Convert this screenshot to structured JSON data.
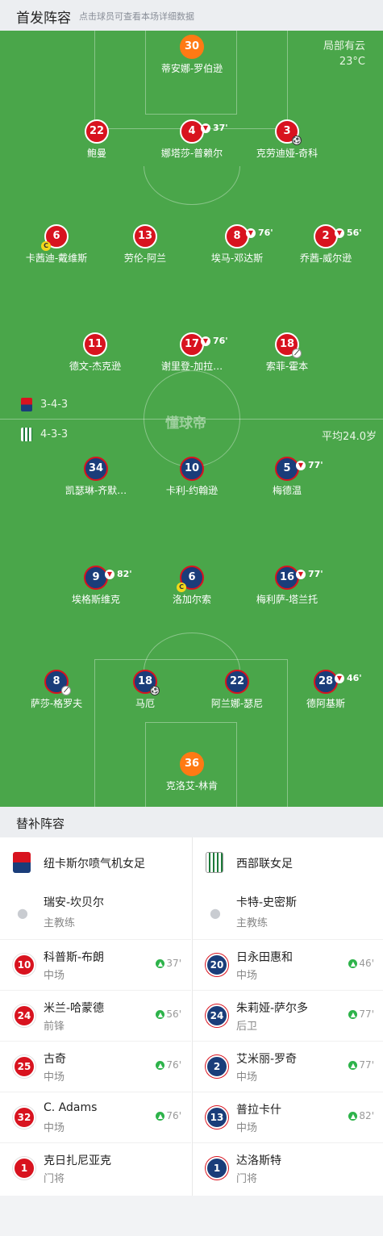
{
  "header": {
    "title": "首发阵容",
    "subtitle": "点击球员可查看本场详细数据"
  },
  "pitch": {
    "watermark": "懂球帝",
    "weather": "局部有云",
    "temperature": "23°C",
    "home_formation": "3-4-3",
    "away_formation": "4-3-3",
    "away_avg_age": "平均24.0岁"
  },
  "home_players": [
    {
      "number": "30",
      "name": "蒂安娜-罗伯逊",
      "kind": "gk"
    },
    {
      "number": "22",
      "name": "鲍曼",
      "kind": "red"
    },
    {
      "number": "4",
      "name": "娜塔莎-普赖尔",
      "kind": "red",
      "sub_minute": "37'"
    },
    {
      "number": "3",
      "name": "克劳迪娅-奇科",
      "kind": "red",
      "goal": true
    },
    {
      "number": "6",
      "name": "卡茜迪-戴维斯",
      "kind": "red",
      "captain": "C"
    },
    {
      "number": "13",
      "name": "劳伦-阿兰",
      "kind": "red"
    },
    {
      "number": "8",
      "name": "埃马-邓达斯",
      "kind": "red",
      "sub_minute": "76'"
    },
    {
      "number": "2",
      "name": "乔茜-威尔逊",
      "kind": "red",
      "sub_minute": "56'"
    },
    {
      "number": "11",
      "name": "德文-杰克逊",
      "kind": "red"
    },
    {
      "number": "17",
      "name": "谢里登-加拉…",
      "kind": "red",
      "sub_minute": "76'"
    },
    {
      "number": "18",
      "name": "索菲-霍本",
      "kind": "red",
      "assist": true
    }
  ],
  "away_players": [
    {
      "number": "34",
      "name": "凯瑟琳-齐默…",
      "kind": "blue"
    },
    {
      "number": "10",
      "name": "卡利-约翰逊",
      "kind": "blue"
    },
    {
      "number": "5",
      "name": "梅德温",
      "kind": "blue",
      "sub_minute": "77'"
    },
    {
      "number": "9",
      "name": "埃格斯维克",
      "kind": "blue",
      "sub_minute": "82'"
    },
    {
      "number": "6",
      "name": "洛加尔索",
      "kind": "blue",
      "captain": "C"
    },
    {
      "number": "16",
      "name": "梅利萨-塔兰托",
      "kind": "blue",
      "sub_minute": "77'"
    },
    {
      "number": "8",
      "name": "萨莎-格罗夫",
      "kind": "blue",
      "assist": true
    },
    {
      "number": "18",
      "name": "马厄",
      "kind": "blue",
      "goal": true
    },
    {
      "number": "22",
      "name": "阿兰娜-瑟尼",
      "kind": "blue"
    },
    {
      "number": "28",
      "name": "德阿基斯",
      "kind": "blue",
      "sub_minute": "46'"
    },
    {
      "number": "36",
      "name": "克洛艾-林肯",
      "kind": "gk"
    }
  ],
  "subs": {
    "title": "替补阵容",
    "home": {
      "team": "纽卡斯尔喷气机女足",
      "coach": {
        "name": "瑞安-坎贝尔",
        "role": "主教练"
      },
      "players": [
        {
          "number": "10",
          "name": "科普斯-布朗",
          "position": "中场",
          "minute": "37'"
        },
        {
          "number": "24",
          "name": "米兰-哈蒙德",
          "position": "前锋",
          "minute": "56'"
        },
        {
          "number": "25",
          "name": "古奇",
          "position": "中场",
          "minute": "76'"
        },
        {
          "number": "32",
          "name": "C. Adams",
          "position": "中场",
          "minute": "76'"
        },
        {
          "number": "1",
          "name": "克日扎尼亚克",
          "position": "门将",
          "minute": ""
        }
      ]
    },
    "away": {
      "team": "西部联女足",
      "coach": {
        "name": "卡特-史密斯",
        "role": "主教练"
      },
      "players": [
        {
          "number": "20",
          "name": "日永田惠和",
          "position": "中场",
          "minute": "46'"
        },
        {
          "number": "24",
          "name": "朱莉娅-萨尔多",
          "position": "后卫",
          "minute": "77'"
        },
        {
          "number": "2",
          "name": "艾米丽-罗奇",
          "position": "中场",
          "minute": "77'"
        },
        {
          "number": "13",
          "name": "普拉卡什",
          "position": "中场",
          "minute": "82'"
        },
        {
          "number": "1",
          "name": "达洛斯特",
          "position": "门将",
          "minute": ""
        }
      ]
    }
  },
  "colors": {
    "pitch": "#4aa64a",
    "home": "#d8131f",
    "away": "#1a3d7a",
    "gk": "#ff7a14",
    "sub_in": "#2db34a"
  }
}
